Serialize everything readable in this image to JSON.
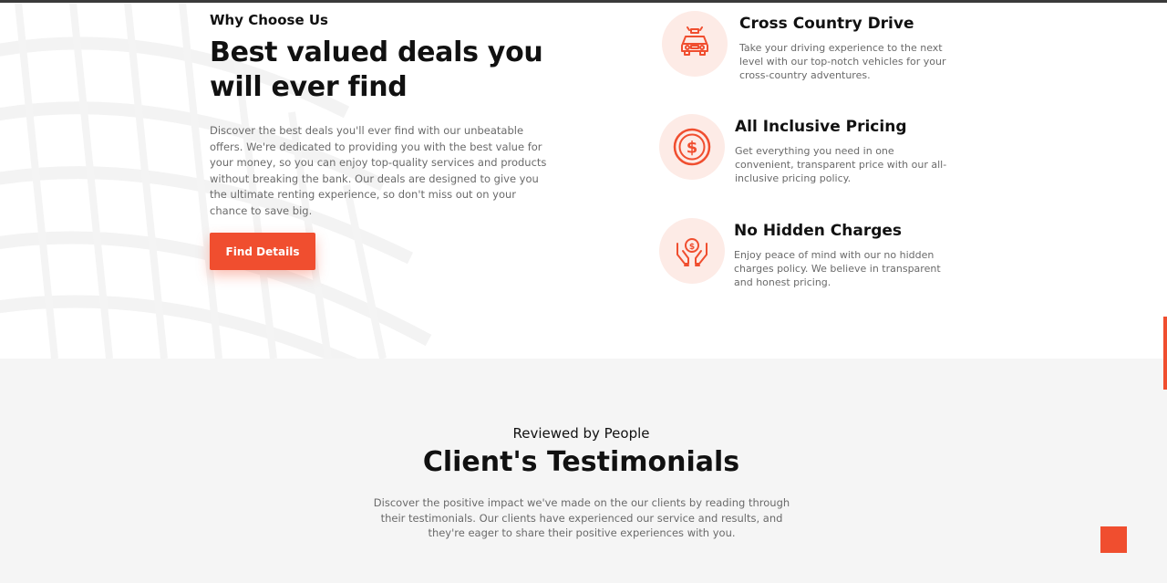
{
  "why_section": {
    "kicker": "Why Choose Us",
    "heading": "Best valued deals you will ever find",
    "description": "Discover the best deals you'll ever find with our unbeatable offers. We're dedicated to providing you with the best value for your money, so you can enjoy top-quality services and products without breaking the bank. Our deals are designed to give you the ultimate renting experience, so don't miss out on your chance to save big.",
    "button_label": "Find Details",
    "features": [
      {
        "icon": "car-icon",
        "title": "Cross Country Drive",
        "description": "Take your driving experience to the next level with our top-notch vehicles for your cross-country adventures."
      },
      {
        "icon": "dollar-coin-icon",
        "title": "All Inclusive Pricing",
        "description": "Get everything you need in one convenient, transparent price with our all-inclusive pricing policy."
      },
      {
        "icon": "hands-coin-icon",
        "title": "No Hidden Charges",
        "description": "Enjoy peace of mind with our no hidden charges policy. We believe in transparent and honest pricing."
      }
    ]
  },
  "testimonials": {
    "kicker": "Reviewed by People",
    "heading": "Client's Testimonials",
    "description": "Discover the positive impact we've made on the our clients by reading through their testimonials. Our clients have experienced our service and results, and they're eager to share their positive experiences with you."
  },
  "colors": {
    "accent": "#f04e2f",
    "icon_bg": "#fdebe6",
    "section_bg": "#f5f5f5",
    "text_muted": "#6a6a6a"
  }
}
